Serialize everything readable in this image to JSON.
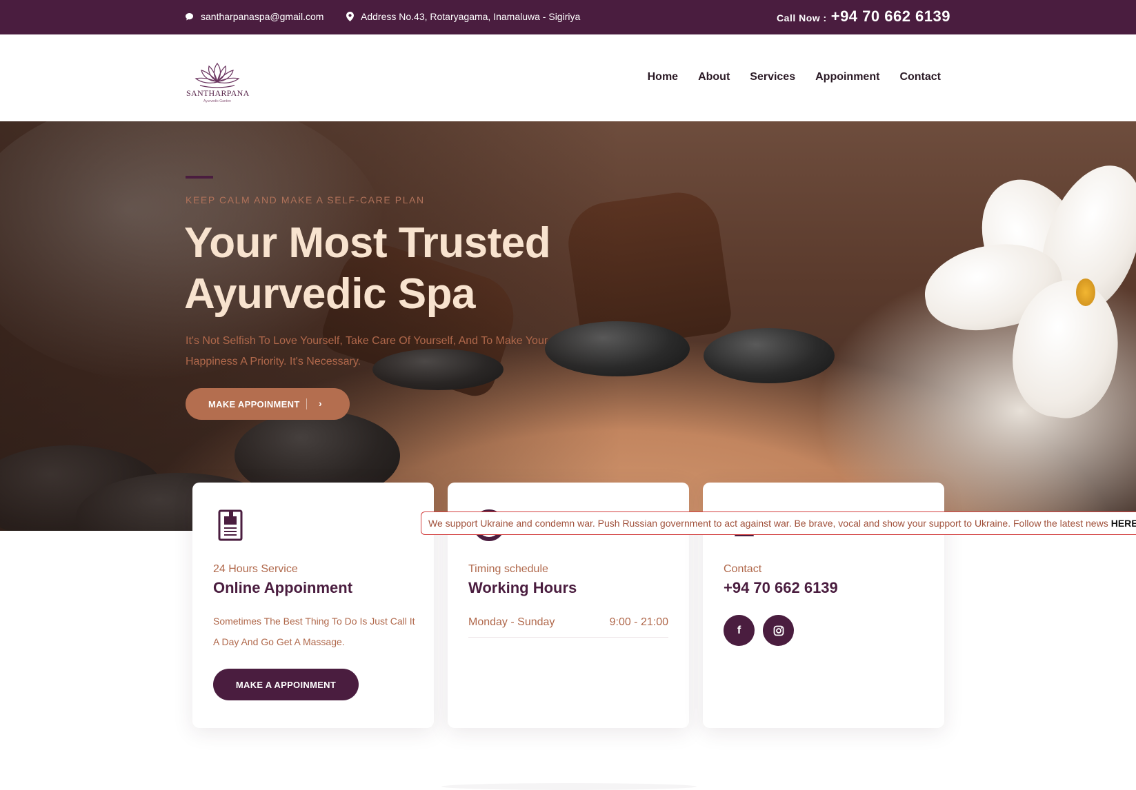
{
  "topbar": {
    "email": "santharpanaspa@gmail.com",
    "email_icon": "chat-bubble-icon",
    "address": "Address No.43, Rotaryagama, Inamaluwa - Sigiriya",
    "address_icon": "map-pin-icon",
    "call_label": "Call Now :",
    "call_number": "+94 70 662 6139"
  },
  "header": {
    "logo_text": "SANTHARPANA",
    "logo_sub": "Ayurvedic Garden",
    "nav": [
      "Home",
      "About",
      "Services",
      "Appoinment",
      "Contact"
    ]
  },
  "hero": {
    "kicker": "KEEP CALM AND MAKE A SELF-CARE PLAN",
    "title_line1": "Your Most Trusted",
    "title_line2": "Ayurvedic Spa",
    "description": "It's Not Selfish To Love Yourself, Take Care Of Yourself, And To Make Your Happiness A Priority. It's Necessary.",
    "button_label": "MAKE APPOINMENT"
  },
  "cards": {
    "service": {
      "icon": "document-icon",
      "kicker": "24 Hours Service",
      "title": "Online Appoinment",
      "description": "Sometimes The Best Thing To Do Is Just Call It A Day And Go Get A Massage.",
      "button_label": "MAKE A APPOINMENT"
    },
    "timing": {
      "icon": "clock-icon",
      "kicker": "Timing schedule",
      "title": "Working Hours",
      "days": "Monday - Sunday",
      "hours": "9:00 - 21:00"
    },
    "contact": {
      "icon": "phone-icon",
      "kicker": "Contact",
      "title": "+94 70 662 6139",
      "social": [
        "facebook-icon",
        "instagram-icon"
      ]
    }
  },
  "banner": {
    "text": "We support Ukraine and condemn war. Push Russian government to act against war. Be brave, vocal and show your support to Ukraine. Follow the latest news",
    "link": "HERE"
  },
  "colors": {
    "brand": "#4a1d3f",
    "accent": "#b46e4f",
    "text_warm": "#b0684b",
    "hero_title": "#f8e3cf"
  }
}
